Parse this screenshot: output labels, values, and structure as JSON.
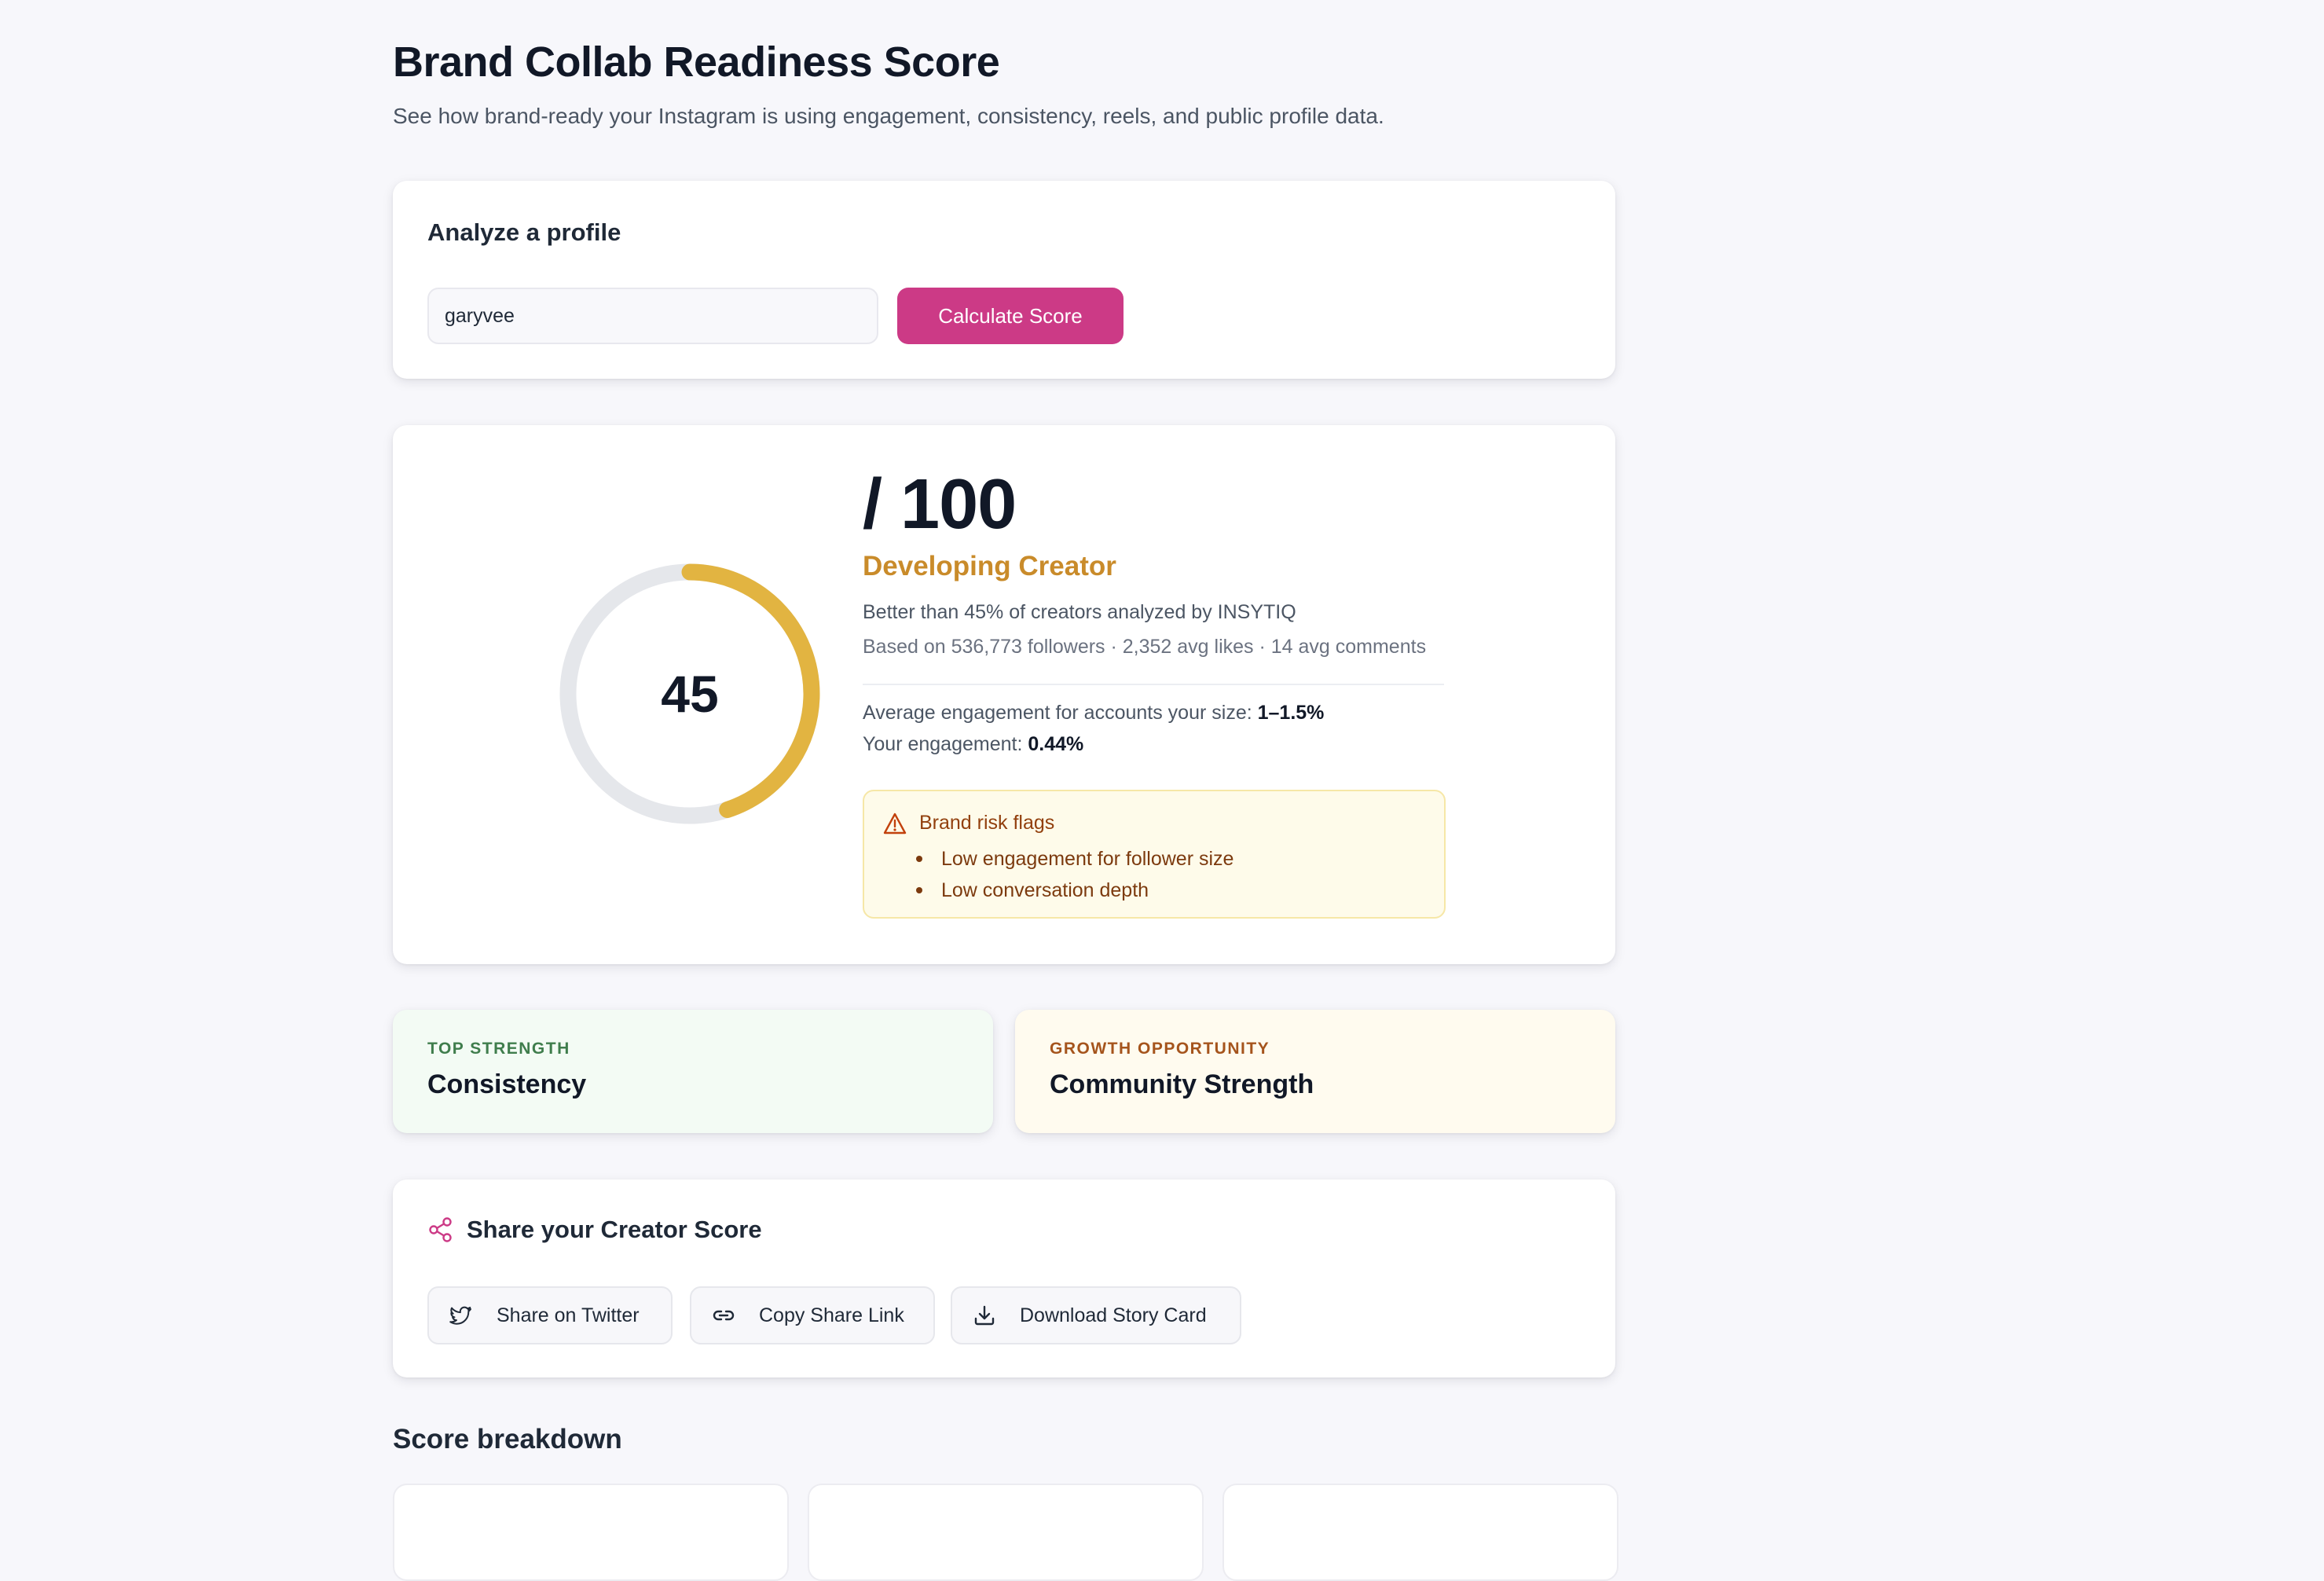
{
  "header": {
    "title": "Brand Collab Readiness Score",
    "subtitle": "See how brand-ready your Instagram is using engagement, consistency, reels, and public profile data."
  },
  "analyze": {
    "heading": "Analyze a profile",
    "input_value": "garyvee",
    "button_label": "Calculate Score"
  },
  "score": {
    "value": "45",
    "value_fraction": 0.45,
    "out_of": "/ 100",
    "tier": "Developing Creator",
    "percentile_text": "Better than 45% of creators analyzed by INSYTIQ",
    "based_on_text": "Based on 536,773 followers · 2,352 avg likes · 14 avg comments",
    "avg_engagement_label": "Average engagement for accounts your size: ",
    "avg_engagement_value": "1–1.5%",
    "your_engagement_label": "Your engagement: ",
    "your_engagement_value": "0.44%"
  },
  "risk": {
    "icon": "warning-icon",
    "title": "Brand risk flags",
    "items": [
      "Low engagement for follower size",
      "Low conversation depth"
    ]
  },
  "strengths": {
    "top": {
      "kicker": "TOP STRENGTH",
      "value": "Consistency"
    },
    "growth": {
      "kicker": "GROWTH OPPORTUNITY",
      "value": "Community Strength"
    }
  },
  "share": {
    "icon": "share-icon",
    "heading": "Share your Creator Score",
    "buttons": [
      {
        "icon": "twitter-bird-icon",
        "label": "Share on Twitter"
      },
      {
        "icon": "link-icon",
        "label": "Copy Share Link"
      },
      {
        "icon": "download-icon",
        "label": "Download Story Card"
      }
    ]
  },
  "breakdown": {
    "heading": "Score breakdown"
  },
  "colors": {
    "accent": "#cc3a86",
    "gauge": "#e2b441",
    "gauge_track": "#e5e7eb",
    "tier": "#c98b2a",
    "strength_green": "#3f7d4c",
    "growth_orange": "#a5541c",
    "risk_text": "#92400e"
  }
}
